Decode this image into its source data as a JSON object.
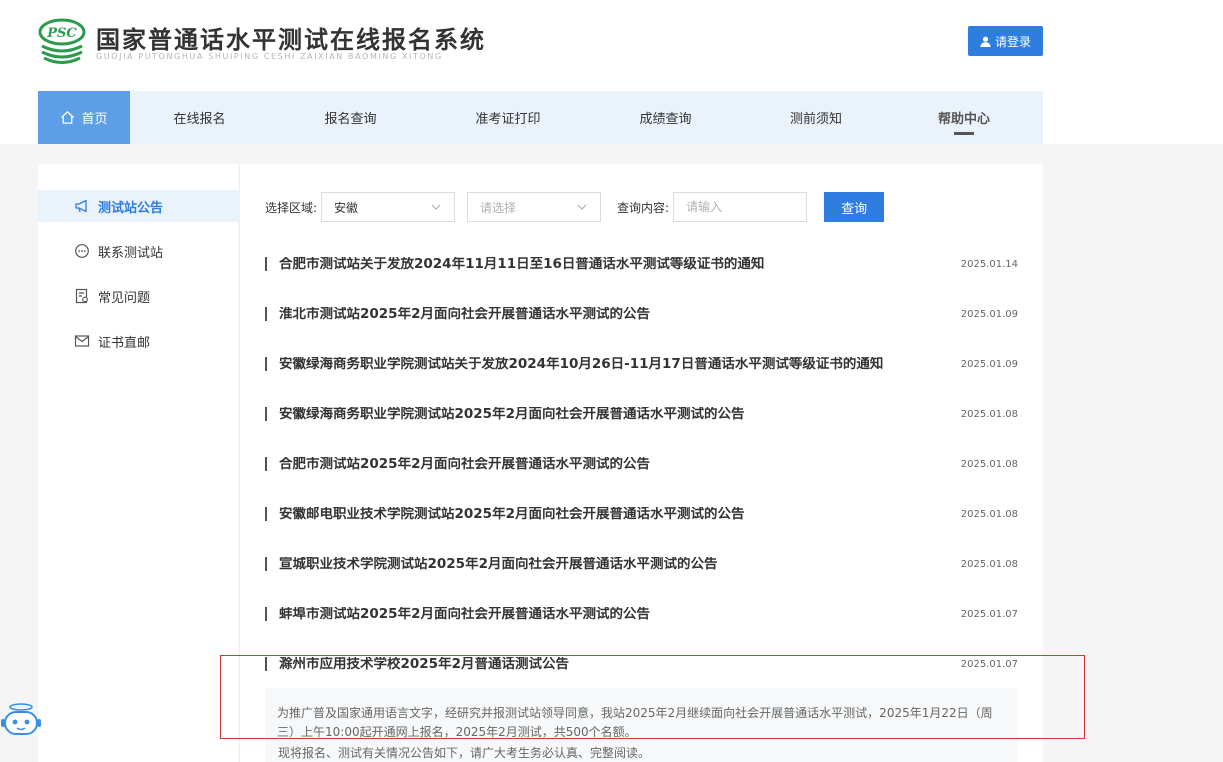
{
  "brand": {
    "badge_text": "PSC",
    "title": "国家普通话水平测试在线报名系统",
    "subtitle": "GUOJIA PUTONGHUA SHUIPING CESHI ZAIXIAN BAOMING XITONG",
    "accent_color": "#2f7de1"
  },
  "header": {
    "login_label": "请登录"
  },
  "nav": {
    "items": [
      {
        "label": "首页"
      },
      {
        "label": "在线报名"
      },
      {
        "label": "报名查询"
      },
      {
        "label": "准考证打印"
      },
      {
        "label": "成绩查询"
      },
      {
        "label": "测前须知"
      },
      {
        "label": "帮助中心"
      }
    ]
  },
  "sidebar": {
    "items": [
      {
        "label": "测试站公告",
        "icon": "megaphone-icon"
      },
      {
        "label": "联系测试站",
        "icon": "chat-icon"
      },
      {
        "label": "常见问题",
        "icon": "faq-icon"
      },
      {
        "label": "证书直邮",
        "icon": "mail-icon"
      }
    ]
  },
  "filters": {
    "region_label": "选择区域:",
    "province_value": "安徽",
    "city_placeholder": "请选择",
    "content_label": "查询内容:",
    "content_placeholder": "请输入",
    "query_label": "查询"
  },
  "announcements": [
    {
      "title": "合肥市测试站关于发放2024年11月11日至16日普通话水平测试等级证书的通知",
      "date": "2025.01.14"
    },
    {
      "title": "淮北市测试站2025年2月面向社会开展普通话水平测试的公告",
      "date": "2025.01.09"
    },
    {
      "title": "安徽绿海商务职业学院测试站关于发放2024年10月26日-11月17日普通话水平测试等级证书的通知",
      "date": "2025.01.09"
    },
    {
      "title": "安徽绿海商务职业学院测试站2025年2月面向社会开展普通话水平测试的公告",
      "date": "2025.01.08"
    },
    {
      "title": "合肥市测试站2025年2月面向社会开展普通话水平测试的公告",
      "date": "2025.01.08"
    },
    {
      "title": "安徽邮电职业技术学院测试站2025年2月面向社会开展普通话水平测试的公告",
      "date": "2025.01.08"
    },
    {
      "title": "宣城职业技术学院测试站2025年2月面向社会开展普通话水平测试的公告",
      "date": "2025.01.08"
    },
    {
      "title": "蚌埠市测试站2025年2月面向社会开展普通话水平测试的公告",
      "date": "2025.01.07"
    },
    {
      "title": "滁州市应用技术学校2025年2月普通话测试公告",
      "date": "2025.01.07"
    }
  ],
  "summary": {
    "text": "为推广普及国家通用语言文字，经研究并报测试站领导同意，我站2025年2月继续面向社会开展普通话水平测试，2025年1月22日（周三）上午10:00起开通网上报名，2025年2月测试，共500个名额。",
    "line2": "现将报名、测试有关情况公告如下，请广大考生务必认真、完整阅读。"
  }
}
